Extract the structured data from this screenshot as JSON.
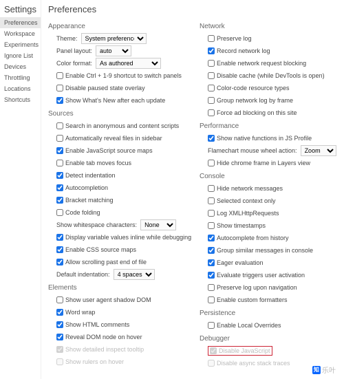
{
  "sidebar": {
    "title": "Settings",
    "items": [
      "Preferences",
      "Workspace",
      "Experiments",
      "Ignore List",
      "Devices",
      "Throttling",
      "Locations",
      "Shortcuts"
    ],
    "activeIndex": 0
  },
  "page": {
    "title": "Preferences"
  },
  "appearance": {
    "title": "Appearance",
    "theme": {
      "label": "Theme:",
      "value": "System preference"
    },
    "panel_layout": {
      "label": "Panel layout:",
      "value": "auto"
    },
    "color_format": {
      "label": "Color format:",
      "value": "As authored"
    },
    "opt1": {
      "label": "Enable Ctrl + 1-9 shortcut to switch panels",
      "checked": false
    },
    "opt2": {
      "label": "Disable paused state overlay",
      "checked": false
    },
    "opt3": {
      "label": "Show What's New after each update",
      "checked": true
    }
  },
  "sources": {
    "title": "Sources",
    "opt1": {
      "label": "Search in anonymous and content scripts",
      "checked": false
    },
    "opt2": {
      "label": "Automatically reveal files in sidebar",
      "checked": false
    },
    "opt3": {
      "label": "Enable JavaScript source maps",
      "checked": true
    },
    "opt4": {
      "label": "Enable tab moves focus",
      "checked": false
    },
    "opt5": {
      "label": "Detect indentation",
      "checked": true
    },
    "opt6": {
      "label": "Autocompletion",
      "checked": true
    },
    "opt7": {
      "label": "Bracket matching",
      "checked": true
    },
    "opt8": {
      "label": "Code folding",
      "checked": false
    },
    "whitespace": {
      "label": "Show whitespace characters:",
      "value": "None"
    },
    "opt9": {
      "label": "Display variable values inline while debugging",
      "checked": true
    },
    "opt10": {
      "label": "Enable CSS source maps",
      "checked": true
    },
    "opt11": {
      "label": "Allow scrolling past end of file",
      "checked": true
    },
    "default_indent": {
      "label": "Default indentation:",
      "value": "4 spaces"
    }
  },
  "elements": {
    "title": "Elements",
    "opt1": {
      "label": "Show user agent shadow DOM",
      "checked": false
    },
    "opt2": {
      "label": "Word wrap",
      "checked": true
    },
    "opt3": {
      "label": "Show HTML comments",
      "checked": true
    },
    "opt4": {
      "label": "Reveal DOM node on hover",
      "checked": true
    },
    "opt5": {
      "label": "Show detailed inspect tooltip",
      "checked": true,
      "disabled": true
    },
    "opt6": {
      "label": "Show rulers on hover",
      "checked": false,
      "disabled": true
    }
  },
  "network": {
    "title": "Network",
    "opt1": {
      "label": "Preserve log",
      "checked": false
    },
    "opt2": {
      "label": "Record network log",
      "checked": true
    },
    "opt3": {
      "label": "Enable network request blocking",
      "checked": false
    },
    "opt4": {
      "label": "Disable cache (while DevTools is open)",
      "checked": false
    },
    "opt5": {
      "label": "Color-code resource types",
      "checked": false
    },
    "opt6": {
      "label": "Group network log by frame",
      "checked": false
    },
    "opt7": {
      "label": "Force ad blocking on this site",
      "checked": false
    }
  },
  "performance": {
    "title": "Performance",
    "opt1": {
      "label": "Show native functions in JS Profile",
      "checked": true
    },
    "flamechart": {
      "label": "Flamechart mouse wheel action:",
      "value": "Zoom"
    },
    "opt2": {
      "label": "Hide chrome frame in Layers view",
      "checked": false
    }
  },
  "console": {
    "title": "Console",
    "opt1": {
      "label": "Hide network messages",
      "checked": false
    },
    "opt2": {
      "label": "Selected context only",
      "checked": false
    },
    "opt3": {
      "label": "Log XMLHttpRequests",
      "checked": false
    },
    "opt4": {
      "label": "Show timestamps",
      "checked": false
    },
    "opt5": {
      "label": "Autocomplete from history",
      "checked": true
    },
    "opt6": {
      "label": "Group similar messages in console",
      "checked": true
    },
    "opt7": {
      "label": "Eager evaluation",
      "checked": true
    },
    "opt8": {
      "label": "Evaluate triggers user activation",
      "checked": true
    },
    "opt9": {
      "label": "Preserve log upon navigation",
      "checked": false
    },
    "opt10": {
      "label": "Enable custom formatters",
      "checked": false
    }
  },
  "persistence": {
    "title": "Persistence",
    "opt1": {
      "label": "Enable Local Overrides",
      "checked": false
    }
  },
  "debugger": {
    "title": "Debugger",
    "opt1": {
      "label": "Disable JavaScript",
      "checked": true,
      "disabled": true,
      "highlight": true
    },
    "opt2": {
      "label": "Disable async stack traces",
      "checked": false,
      "disabled": true
    }
  },
  "watermark": {
    "logo": "知",
    "text": "乐叶"
  }
}
